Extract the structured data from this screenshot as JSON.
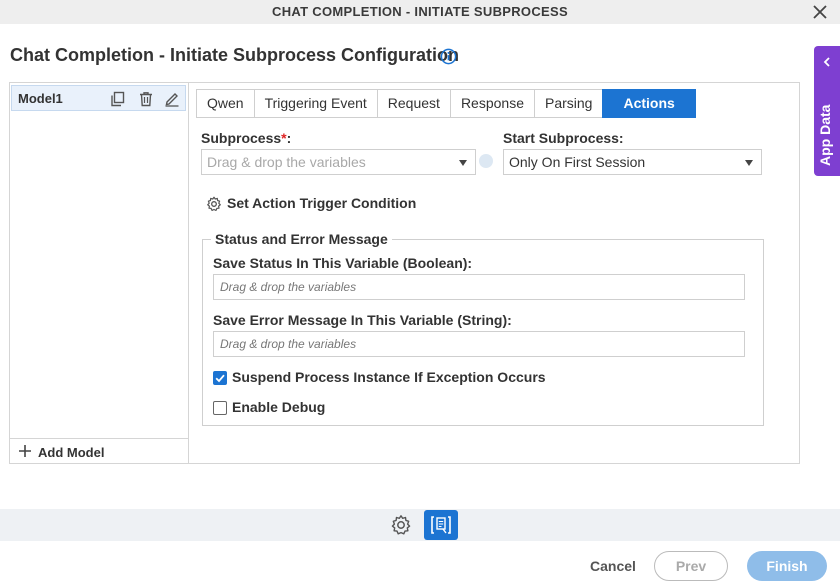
{
  "window": {
    "title": "CHAT COMPLETION - INITIATE SUBPROCESS",
    "close_icon": "close-icon"
  },
  "page": {
    "heading": "Chat Completion - Initiate Subprocess Configuration",
    "info_icon": "info-icon"
  },
  "app_data": {
    "label": "App Data",
    "icon": "chevron-left-icon"
  },
  "models": {
    "items": [
      {
        "label": "Model1",
        "icons": [
          "copy-icon",
          "trash-icon",
          "edit-icon"
        ]
      }
    ],
    "add_label": "Add Model"
  },
  "tabs": [
    {
      "label": "Qwen",
      "active": false
    },
    {
      "label": "Triggering Event",
      "active": false
    },
    {
      "label": "Request",
      "active": false
    },
    {
      "label": "Response",
      "active": false
    },
    {
      "label": "Parsing",
      "active": false
    },
    {
      "label": "Actions",
      "active": true
    }
  ],
  "actions": {
    "subprocess_label": "Subprocess",
    "subprocess_required_mark": "*",
    "subprocess_colon": ":",
    "subprocess_placeholder": "Drag & drop the variables",
    "start_subprocess_label": "Start Subprocess:",
    "start_subprocess_value": "Only On First Session",
    "trigger_condition_label": "Set Action Trigger Condition",
    "status_group": {
      "legend": "Status and Error Message",
      "save_status_label": "Save Status In This Variable (Boolean):",
      "save_status_placeholder": "Drag & drop the variables",
      "save_error_label": "Save Error Message In This Variable (String):",
      "save_error_placeholder": "Drag & drop the variables"
    },
    "suspend_label": "Suspend Process Instance If Exception Occurs",
    "suspend_checked": true,
    "debug_label": "Enable Debug",
    "debug_checked": false
  },
  "footer": {
    "cancel": "Cancel",
    "prev": "Prev",
    "finish": "Finish"
  },
  "colors": {
    "accent": "#1c74d2",
    "app_data": "#7e3fd1",
    "finish_disabled": "#8fbde9"
  }
}
